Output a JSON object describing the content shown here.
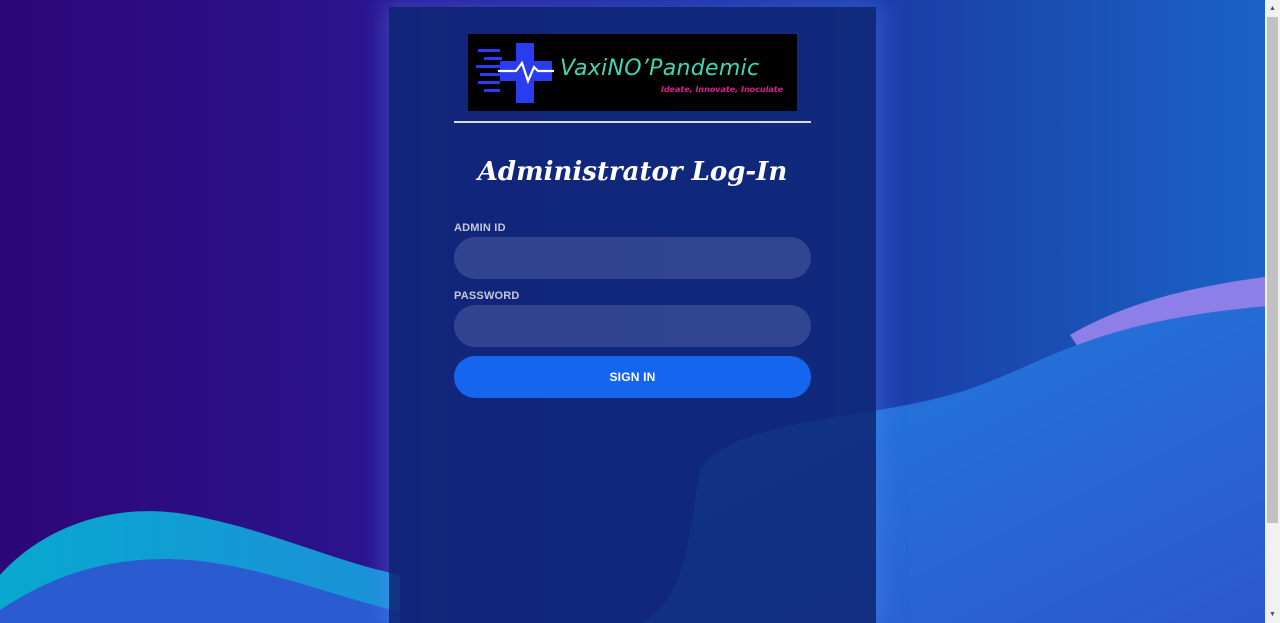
{
  "colors": {
    "card_background": "#0f2876",
    "button": "#1565ef",
    "logo_text": "#3fd8b7",
    "tagline": "#d61f8e"
  },
  "logo": {
    "name": "VaxiNO’Pandemic",
    "tagline": "Ideate, Innovate, Inoculate"
  },
  "title": "Administrator Log-In",
  "form": {
    "admin_id": {
      "label": "ADMIN ID",
      "value": ""
    },
    "password": {
      "label": "PASSWORD",
      "value": ""
    },
    "submit_label": "SIGN IN"
  },
  "scrollbar": {
    "up_icon": "triangle-up",
    "down_icon": "triangle-down"
  }
}
